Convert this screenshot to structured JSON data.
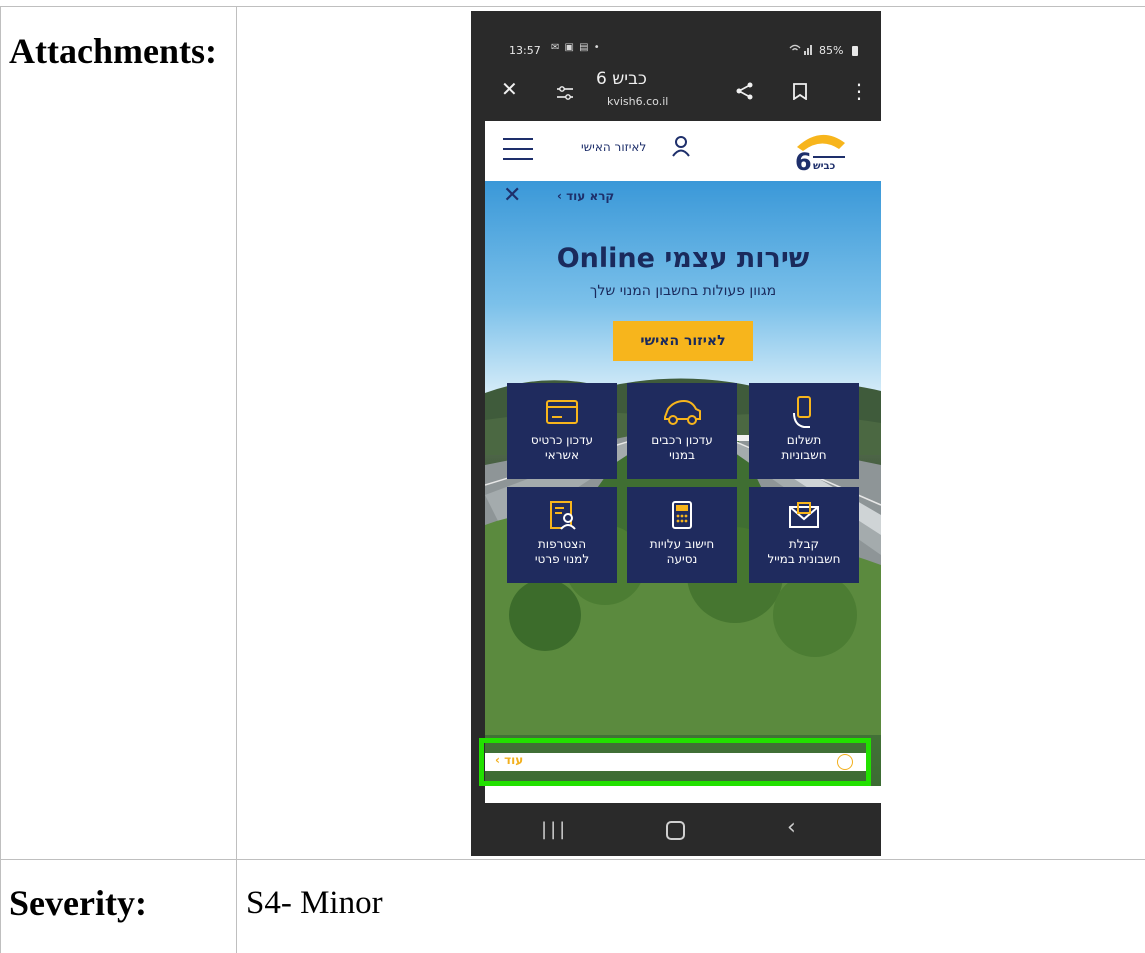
{
  "document": {
    "attachments_label": "Attachments:",
    "severity_label": "Severity:",
    "severity_value": "S4- Minor"
  },
  "phone": {
    "status_bar": {
      "time": "13:57",
      "notification_icons": "✉ ▣ ▤ •",
      "signal_icons": "wifi-icon signal-icon",
      "battery": "85%"
    },
    "browser": {
      "page_title": "כביש 6",
      "url": "kvish6.co.il",
      "icons": [
        "close-icon",
        "tune-icon",
        "share-icon",
        "bookmark-icon",
        "more-icon"
      ]
    },
    "site_header": {
      "personal_area_link": "לאיזור האישי",
      "logo_text": "6 כביש"
    },
    "hero": {
      "read_more": "קרא עוד ›",
      "title": "שירות עצמי Online",
      "subtitle": "מגוון פעולות בחשבון המנוי שלך",
      "cta_label": "לאיזור האישי"
    },
    "services": [
      {
        "label_line1": "תשלום",
        "label_line2": "חשבוניות",
        "icon": "phone-hand-icon"
      },
      {
        "label_line1": "עדכון רכבים",
        "label_line2": "במנוי",
        "icon": "car-icon"
      },
      {
        "label_line1": "עדכון כרטיס",
        "label_line2": "אשראי",
        "icon": "credit-card-icon"
      },
      {
        "label_line1": "קבלת",
        "label_line2": "חשבונית במייל",
        "icon": "mail-icon"
      },
      {
        "label_line1": "חישוב עלויות",
        "label_line2": "נסיעה",
        "icon": "calculator-icon"
      },
      {
        "label_line1": "הצטרפות",
        "label_line2": "למנוי פרטי",
        "icon": "form-user-icon"
      }
    ],
    "more_link": "עוד ›",
    "nav_bar": {
      "icons": [
        "recent-apps-icon",
        "home-icon",
        "back-icon"
      ]
    },
    "colors": {
      "navy": "#1f2b5e",
      "accent": "#f7b51c",
      "highlight": "#22e000"
    }
  }
}
